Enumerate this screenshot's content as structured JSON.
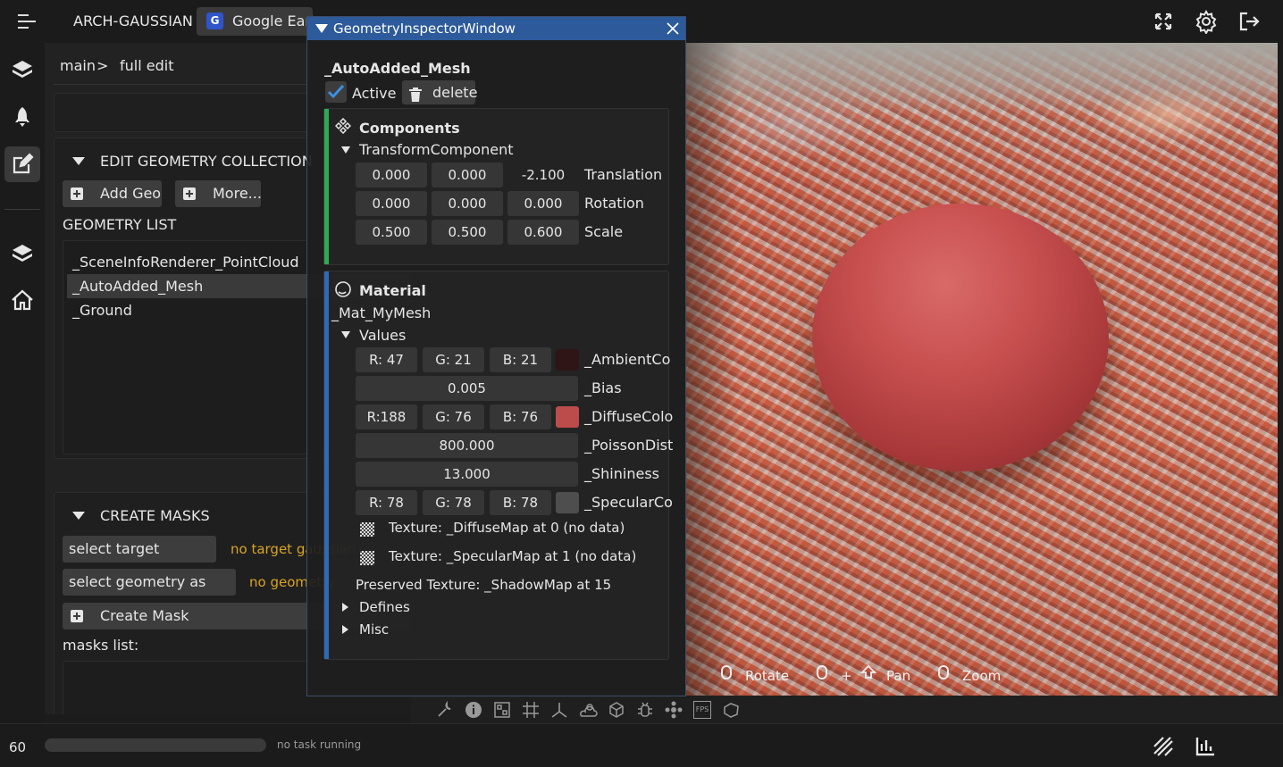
{
  "topbar": {
    "app_title": "ARCH-GAUSSIAN",
    "tab_label": "Google Earth",
    "tab_icon_letter": "G",
    "icons": [
      "menu-icon",
      "fullscreen-icon",
      "settings-icon",
      "logout-icon"
    ]
  },
  "rail": {
    "icons": [
      "layers-icon",
      "rocket-icon",
      "edit-icon",
      "layers-icon",
      "home-icon"
    ],
    "active": "edit-icon"
  },
  "breadcrumb": {
    "root": "main",
    "separator": ">",
    "current": "full edit"
  },
  "geometry_collection": {
    "title": "EDIT GEOMETRY COLLECTION",
    "add_geo_label": "Add Geo",
    "more_label": "More...",
    "list_title": "GEOMETRY LIST",
    "items": [
      "_SceneInfoRenderer_PointCloud",
      "_AutoAdded_Mesh",
      "_Ground"
    ],
    "selected_index": 1
  },
  "masks": {
    "title": "CREATE MASKS",
    "select_gaussian_label": "select target gaussian",
    "no_target_text": "no target gaussian",
    "select_geometry_label": "select geometry as mask",
    "no_geometry_text": "no geometry",
    "create_mask_label": "Create Mask",
    "masks_list_label": "masks list:"
  },
  "inspector": {
    "window_title": "GeometryInspectorWindow",
    "object_name": "_AutoAdded_Mesh",
    "active_label": "Active",
    "active_checked": true,
    "delete_label": "delete",
    "components_title": "Components",
    "transform_title": "TransformComponent",
    "transform": [
      {
        "values": [
          "0.000",
          "0.000",
          "-2.100"
        ],
        "label": "Translation"
      },
      {
        "values": [
          "0.000",
          "0.000",
          "0.000"
        ],
        "label": "Rotation"
      },
      {
        "values": [
          "0.500",
          "0.500",
          "0.600"
        ],
        "label": "Scale"
      }
    ],
    "material_title": "Material",
    "material_name": "_Mat_MyMesh",
    "values_title": "Values",
    "ambient": {
      "r": "R: 47",
      "g": "G: 21",
      "b": "B: 21",
      "label": "_AmbientCo",
      "color": "#2f1515"
    },
    "bias": {
      "value": "0.005",
      "label": "_Bias"
    },
    "diffuse": {
      "r": "R:188",
      "g": "G: 76",
      "b": "B: 76",
      "label": "_DiffuseColo",
      "color": "#bc4c4c"
    },
    "poisson": {
      "value": "800.000",
      "label": "_PoissonDist"
    },
    "shininess": {
      "value": "13.000",
      "label": "_Shininess"
    },
    "specular": {
      "r": "R: 78",
      "g": "G: 78",
      "b": "B: 78",
      "label": "_SpecularCo",
      "color": "#4e4e4e"
    },
    "texture_diffuse": "Texture: _DiffuseMap at 0 (no data)",
    "texture_specular": "Texture: _SpecularMap at 1 (no data)",
    "preserved_texture": "Preserved Texture: _ShadowMap at 15",
    "defines_label": "Defines",
    "misc_label": "Misc"
  },
  "viewport": {
    "hint_rotate": "Rotate",
    "hint_plus": "+",
    "hint_pan": "Pan",
    "hint_zoom": "Zoom",
    "sphere_color": "#c8504f"
  },
  "toolbar": {
    "icons": [
      "wrench-icon",
      "info-icon",
      "qr-icon",
      "grid-icon",
      "axes-icon",
      "weather-icon",
      "cube-icon",
      "bug-icon",
      "splat-icon",
      "fps-icon",
      "box3d-icon"
    ],
    "fps_icon_text": "FPS"
  },
  "status": {
    "fps": "60",
    "task_text": "no task running",
    "icons": [
      "hatch-icon",
      "stats-icon"
    ]
  }
}
